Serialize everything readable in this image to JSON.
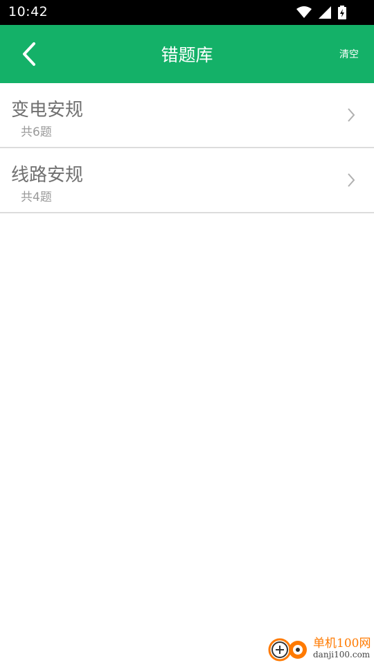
{
  "status_bar": {
    "time": "10:42",
    "icons": [
      "wifi-icon",
      "signal-icon",
      "battery-charging-icon"
    ]
  },
  "app_bar": {
    "title": "错题库",
    "back_icon": "chevron-left-icon",
    "clear_label": "清空",
    "color": "#14b168"
  },
  "categories": [
    {
      "name": "变电安规",
      "count_text": "共6题"
    },
    {
      "name": "线路安规",
      "count_text": "共4题"
    }
  ],
  "watermark": {
    "brand": "单机100网",
    "domain": "danji100.com"
  }
}
